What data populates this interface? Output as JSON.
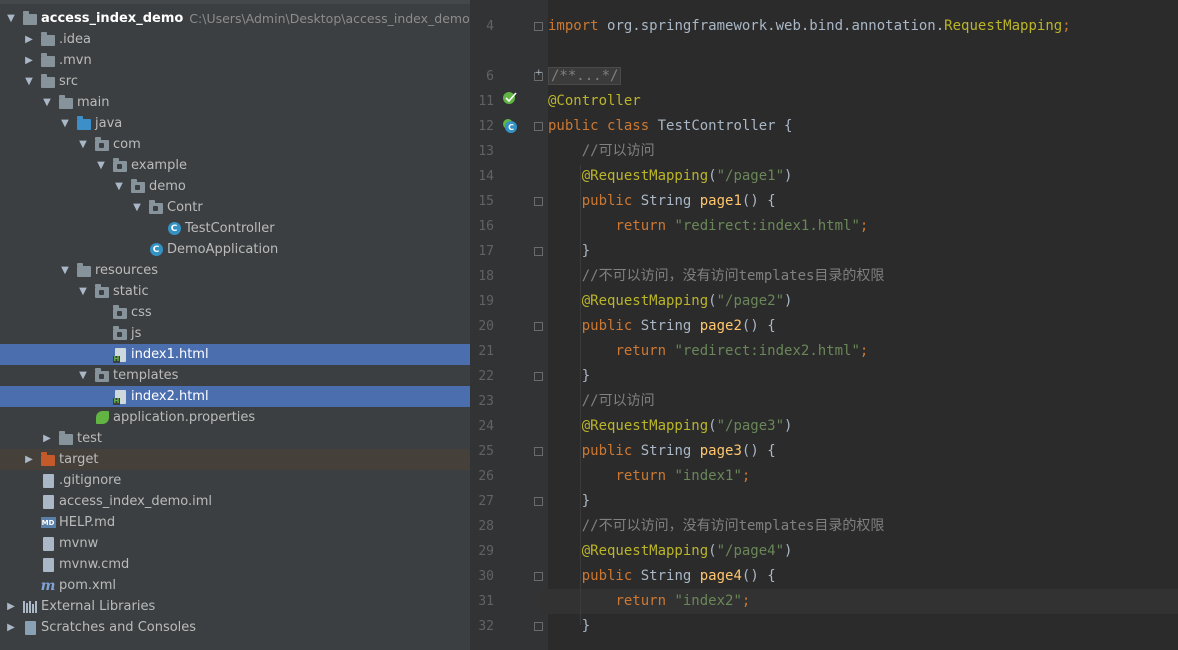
{
  "project_tree": {
    "root": {
      "label": "access_index_demo",
      "path": "C:\\Users\\Admin\\Desktop\\access_index_demo"
    },
    "items": [
      {
        "label": ".idea"
      },
      {
        "label": ".mvn"
      },
      {
        "label": "src"
      },
      {
        "label": "main"
      },
      {
        "label": "java"
      },
      {
        "label": "com"
      },
      {
        "label": "example"
      },
      {
        "label": "demo"
      },
      {
        "label": "Contr"
      },
      {
        "label": "TestController"
      },
      {
        "label": "DemoApplication"
      },
      {
        "label": "resources"
      },
      {
        "label": "static"
      },
      {
        "label": "css"
      },
      {
        "label": "js"
      },
      {
        "label": "index1.html"
      },
      {
        "label": "templates"
      },
      {
        "label": "index2.html"
      },
      {
        "label": "application.properties"
      },
      {
        "label": "test"
      },
      {
        "label": "target"
      },
      {
        "label": ".gitignore"
      },
      {
        "label": "access_index_demo.iml"
      },
      {
        "label": "HELP.md"
      },
      {
        "label": "mvnw"
      },
      {
        "label": "mvnw.cmd"
      },
      {
        "label": "pom.xml"
      },
      {
        "label": "External Libraries"
      },
      {
        "label": "Scratches and Consoles"
      }
    ]
  },
  "editor": {
    "line_numbers": [
      "4",
      "6",
      "11",
      "12",
      "13",
      "14",
      "15",
      "16",
      "17",
      "18",
      "19",
      "20",
      "21",
      "22",
      "23",
      "24",
      "25",
      "26",
      "27",
      "28",
      "29",
      "30",
      "31",
      "32"
    ],
    "code": {
      "import_kw": "import",
      "import_pkg": "org.springframework.web.bind.annotation.",
      "import_cls": "RequestMapping",
      "import_semi": ";",
      "doc_collapsed": "/**...*/",
      "controller_ann": "@Controller",
      "class_public": "public",
      "class_kw": "class",
      "class_name": "TestController {",
      "comment_allowed": "//可以访问",
      "comment_denied": "//不可以访问，没有访问templates目录的权限",
      "req_ann": "@RequestMapping",
      "page1_path": "\"/page1\"",
      "page2_path": "\"/page2\"",
      "page3_path": "\"/page3\"",
      "page4_path": "\"/page4\"",
      "public_kw": "public",
      "string_type": "String",
      "page1_method": "page1",
      "page2_method": "page2",
      "page3_method": "page3",
      "page4_method": "page4",
      "method_params": "() {",
      "return_kw": "return",
      "ret1": "\"redirect:index1.html\"",
      "ret2": "\"redirect:index2.html\"",
      "ret3": "\"index1\"",
      "ret4": "\"index2\"",
      "close_brace": "}",
      "open_paren": "(",
      "close_paren": ")",
      "semicolon": ";"
    }
  },
  "colors": {
    "keyword": "#cc7832",
    "annotation": "#bbb529",
    "string": "#6a8759",
    "comment": "#808080",
    "method": "#ffc66d",
    "selection": "#4b6eaf"
  }
}
